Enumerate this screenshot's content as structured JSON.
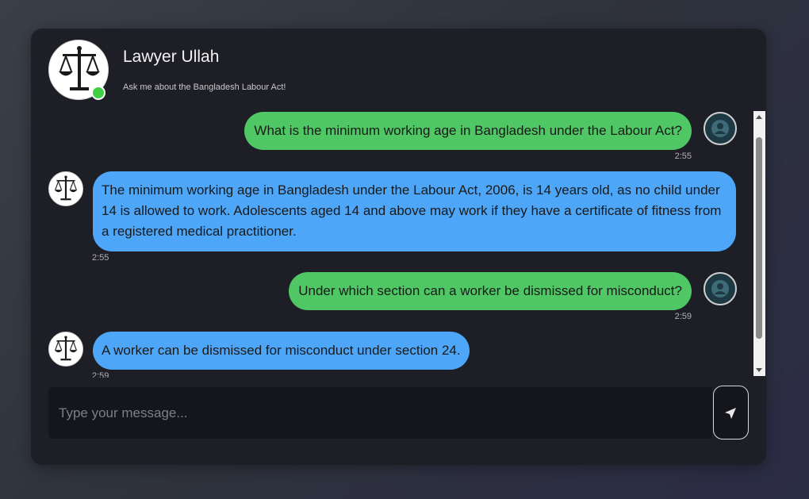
{
  "header": {
    "title": "Lawyer Ullah",
    "subtitle": "Ask me about the Bangladesh Labour Act!",
    "status_color": "#3fcf45"
  },
  "messages": [
    {
      "sender": "user",
      "text": "What is the minimum working age in Bangladesh under the Labour Act?",
      "time": "2:55"
    },
    {
      "sender": "bot",
      "text": "The minimum working age in Bangladesh under the Labour Act, 2006, is 14 years old, as no child under 14 is allowed to work. Adolescents aged 14 and above may work if they have a certificate of fitness from a registered medical practitioner.",
      "time": "2:55"
    },
    {
      "sender": "user",
      "text": "Under which section can a worker be dismissed for misconduct?",
      "time": "2:59"
    },
    {
      "sender": "bot",
      "text": "A worker can be dismissed for misconduct under section 24.",
      "time": "2:59"
    }
  ],
  "input": {
    "placeholder": "Type your message...",
    "value": ""
  },
  "icons": {
    "bot_avatar": "scales-of-justice-icon",
    "user_avatar": "user-silhouette-icon",
    "send": "send-arrow-icon"
  },
  "colors": {
    "user_bubble": "#4fc764",
    "bot_bubble": "#4da6f7",
    "card_bg": "#1e1f26"
  }
}
